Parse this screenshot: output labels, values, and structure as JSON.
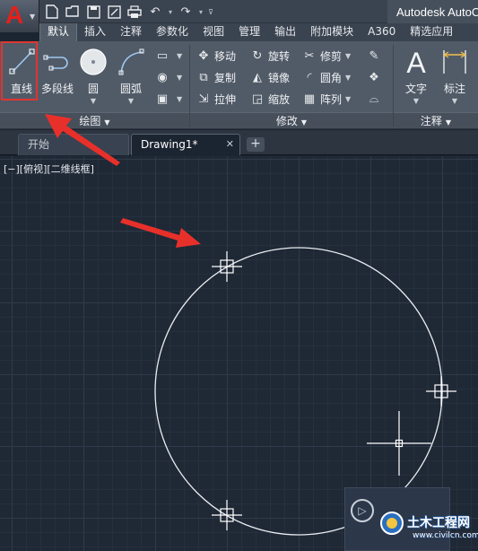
{
  "app": {
    "title": "Autodesk AutoC",
    "logo_letter": "A"
  },
  "quick_access": [
    {
      "name": "new-icon",
      "glyph": "🗋"
    },
    {
      "name": "open-icon",
      "glyph": "🗁"
    },
    {
      "name": "save-icon",
      "glyph": "💾"
    },
    {
      "name": "saveas-icon",
      "glyph": "🖫"
    },
    {
      "name": "print-icon",
      "glyph": "🖶"
    },
    {
      "name": "undo-icon",
      "glyph": "↶"
    },
    {
      "name": "redo-icon",
      "glyph": "↷"
    }
  ],
  "ribbon_tabs": [
    "默认",
    "插入",
    "注释",
    "参数化",
    "视图",
    "管理",
    "输出",
    "附加模块",
    "A360",
    "精选应用"
  ],
  "active_tab_index": 0,
  "panels": {
    "draw": {
      "title": "绘图",
      "line": "直线",
      "polyline": "多段线",
      "circle": "圆",
      "arc": "圆弧"
    },
    "modify": {
      "title": "修改",
      "move": "移动",
      "rotate": "旋转",
      "trim": "修剪",
      "copy": "复制",
      "mirror": "镜像",
      "fillet": "圆角",
      "stretch": "拉伸",
      "scale": "缩放",
      "array": "阵列"
    },
    "annotation": {
      "title": "注释",
      "text": "文字",
      "dimension": "标注"
    }
  },
  "file_tabs": {
    "start": "开始",
    "drawing": "Drawing1*"
  },
  "viewport_label": "[−][俯视][二维线框]",
  "colors": {
    "highlight": "#e0352f",
    "arrow": "#e8302a",
    "canvas": "#1f2835",
    "ribbon": "#515b68",
    "autocad_red": "#e6201a"
  },
  "watermark": {
    "title": "土木工程网",
    "url": "www.civilcn.com"
  }
}
